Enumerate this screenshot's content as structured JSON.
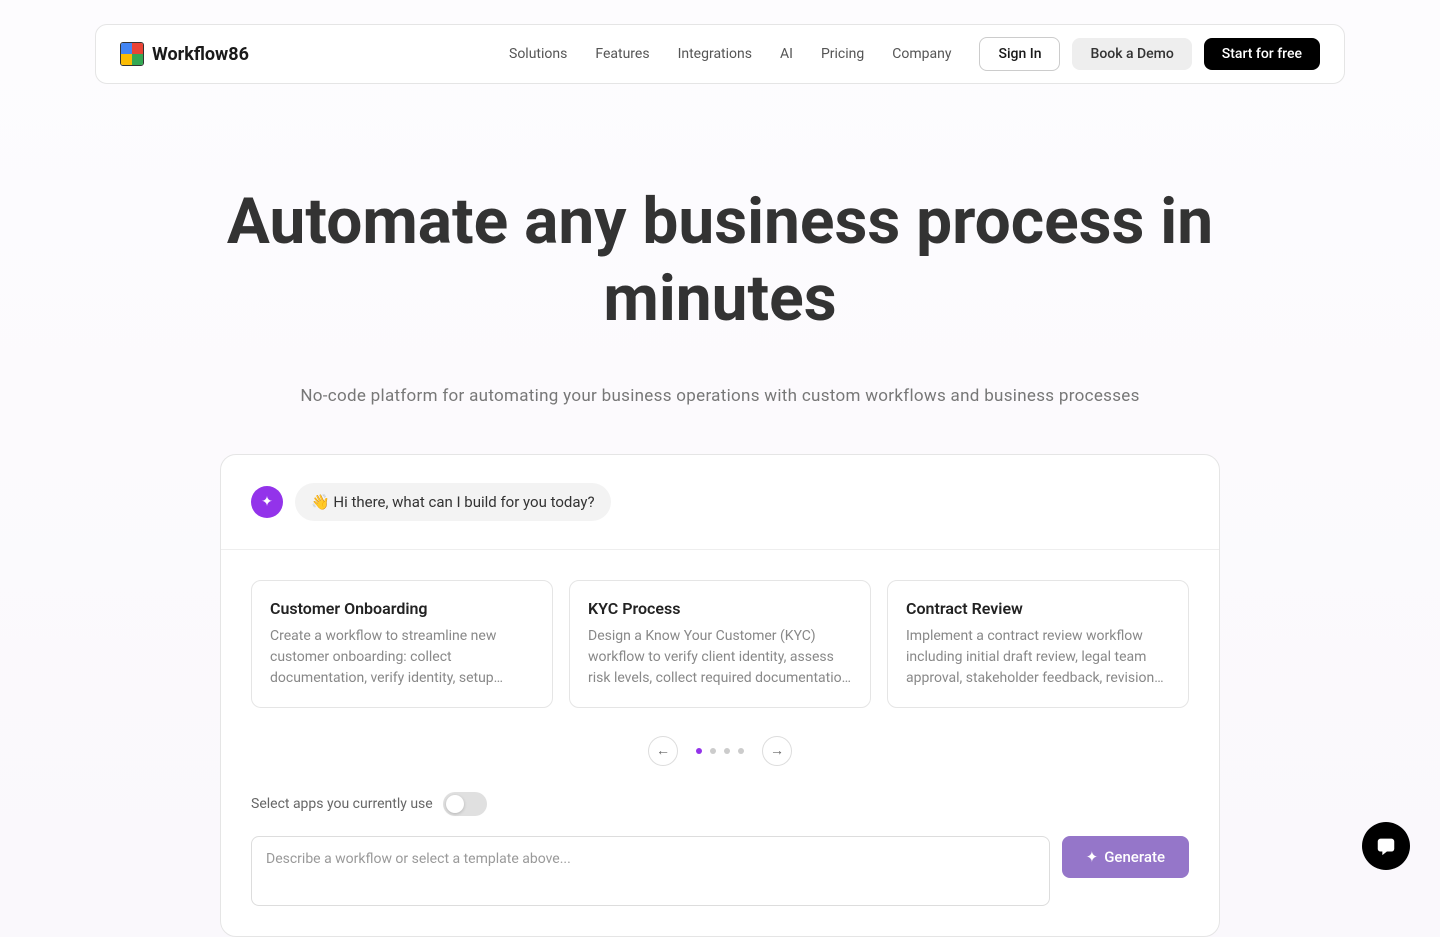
{
  "header": {
    "brand": "Workflow86",
    "nav": [
      "Solutions",
      "Features",
      "Integrations",
      "AI",
      "Pricing",
      "Company"
    ],
    "sign_in": "Sign In",
    "demo": "Book a Demo",
    "start": "Start for free"
  },
  "hero": {
    "title": "Automate any business process in minutes",
    "subtitle": "No-code platform for automating your business operations with custom workflows and business processes"
  },
  "chat": {
    "greeting": "👋 Hi there, what can I build for you today?",
    "cards": [
      {
        "title": "Customer Onboarding",
        "desc": "Create a workflow to streamline new customer onboarding: collect documentation, verify identity, setup…"
      },
      {
        "title": "KYC Process",
        "desc": "Design a Know Your Customer (KYC) workflow to verify client identity, assess risk levels, collect required documentatio…"
      },
      {
        "title": "Contract Review",
        "desc": "Implement a contract review workflow including initial draft review, legal team approval, stakeholder feedback, revision…"
      }
    ],
    "prev": "←",
    "next": "→",
    "toggle_label": "Select apps you currently use",
    "placeholder": "Describe a workflow or select a template above...",
    "generate": "Generate"
  }
}
